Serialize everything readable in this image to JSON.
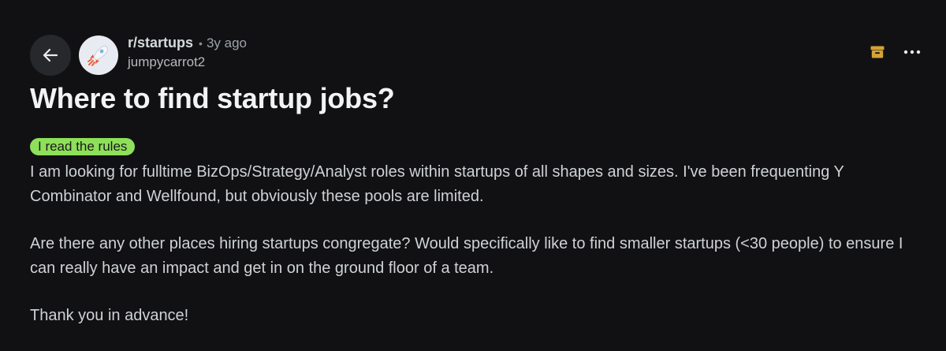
{
  "post": {
    "subreddit": "r/startups",
    "separator": "•",
    "time": "3y ago",
    "author": "jumpycarrot2",
    "title": "Where to find startup jobs?",
    "flair": "I read the rules",
    "paragraphs": [
      "I am looking for fulltime BizOps/Strategy/Analyst roles within startups of all shapes and sizes. I've been frequenting Y Combinator and Wellfound, but obviously these pools are limited.",
      "Are there any other places hiring startups congregate? Would specifically like to find smaller startups (<30 people) to ensure I can really have an impact and get in on the ground floor of a team.",
      "Thank you in advance!"
    ]
  },
  "icons": {
    "back": "back-arrow-icon",
    "avatar": "rocket-icon",
    "archive": "archive-icon",
    "more": "more-options-icon"
  },
  "colors": {
    "background": "#111113",
    "flair": "#8ee05a",
    "archive": "#d4a236"
  }
}
